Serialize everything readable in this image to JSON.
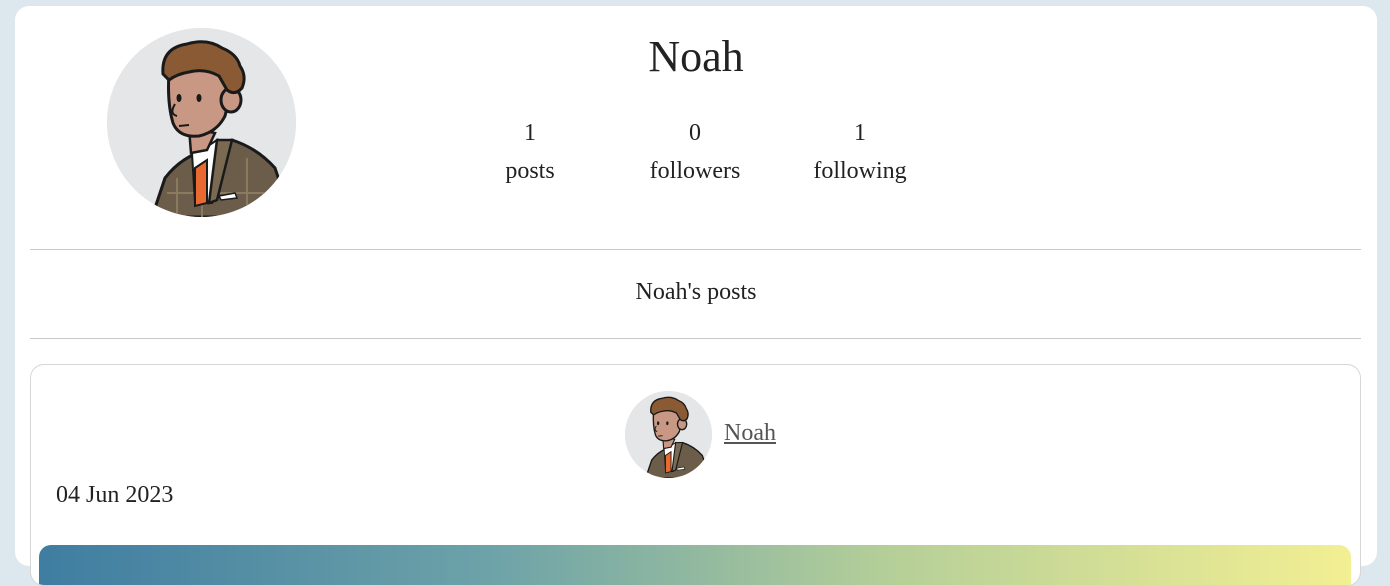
{
  "profile": {
    "username": "Noah",
    "stats": [
      {
        "value": "1",
        "label": "posts"
      },
      {
        "value": "0",
        "label": "followers"
      },
      {
        "value": "1",
        "label": "following"
      }
    ]
  },
  "posts_section": {
    "title": "Noah's posts"
  },
  "post": {
    "author": "Noah",
    "date": "04 Jun 2023"
  },
  "colors": {
    "page_background": "#dde7ee",
    "card_background": "#ffffff",
    "link": "#555555"
  }
}
